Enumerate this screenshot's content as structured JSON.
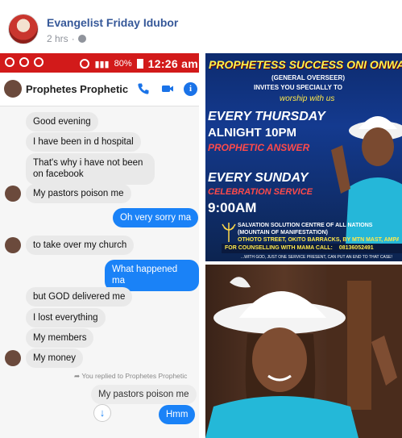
{
  "post": {
    "author": "Evangelist Friday Idubor",
    "time": "2 hrs",
    "separator": "·",
    "privacy_icon": "globe-icon"
  },
  "phone": {
    "status_bar": {
      "battery": "80%",
      "time": "12:26 am",
      "color": "#d21a1a"
    },
    "chat_header": {
      "contact_name": "Prophetes Prophetic",
      "icons": [
        "phone-icon",
        "video-icon",
        "info-icon"
      ],
      "info_glyph": "i"
    },
    "messages": [
      {
        "text": "Good evening",
        "direction": "in"
      },
      {
        "text": "I have been in d hospital",
        "direction": "in"
      },
      {
        "text": "That's why i have not been on facebook",
        "direction": "in"
      },
      {
        "text": "My pastors poison me",
        "direction": "in"
      },
      {
        "text": "Oh very sorry ma",
        "direction": "out"
      },
      {
        "text": "to take over my church",
        "direction": "in"
      },
      {
        "text": "What happened ma",
        "direction": "out"
      },
      {
        "text": "but GOD delivered me",
        "direction": "in"
      },
      {
        "text": "I lost everything",
        "direction": "in"
      },
      {
        "text": "My members",
        "direction": "in"
      },
      {
        "text": "My money",
        "direction": "in"
      }
    ],
    "reply_note": "You replied to Prophetes Prophetic",
    "quoted_message": "My pastors poison me",
    "last_reply": "Hmm",
    "accent_color": "#1a82f7"
  },
  "flyer": {
    "title": "PROPHETESS SUCCESS ONI ONWAEZ",
    "overseer": "(GENERAL OVERSEER)",
    "invite": "INVITES YOU SPECIALLY TO",
    "worship": "worship with us",
    "every_thursday": "EVERY THURSDAY",
    "alnight": "ALNIGHT 10PM",
    "prophetic_answer": "PROPHETIC ANSWER",
    "every_sunday": "EVERY SUNDAY",
    "celebration": "CELEBRATION SERVICE",
    "sunday_time": "9:00AM",
    "church_name": "SALVATION SOLUTION CENTRE OF ALL NATIONS",
    "church_subtitle": "(MOUNTAIN OF MANIFESTATION)",
    "address": "OTHOTO STREET, OKITO BARRACKS, BY MTN MAST, AMPA ROAD, WARRI",
    "counselling": "FOR COUNSELLING WITH MAMA CALL:",
    "phone_number": "08136052491",
    "footer": "...WITH GOD, JUST ONE SERVICE PRESENT, CAN PUT AN END TO THAT CASE!"
  }
}
